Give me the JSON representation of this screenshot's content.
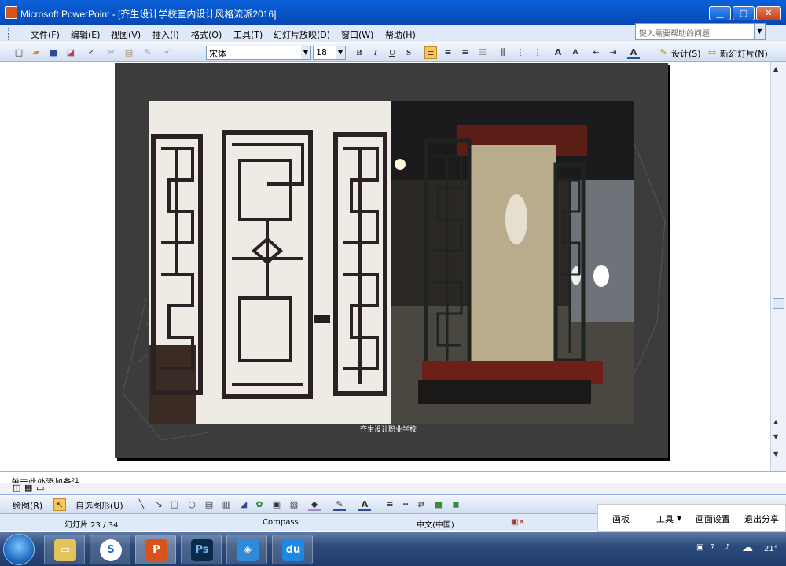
{
  "window": {
    "title": "Microsoft PowerPoint - [齐生设计学校室内设计风格流派2016]"
  },
  "menu": {
    "items": [
      "文件(F)",
      "编辑(E)",
      "视图(V)",
      "插入(I)",
      "格式(O)",
      "工具(T)",
      "幻灯片放映(D)",
      "窗口(W)",
      "帮助(H)"
    ]
  },
  "help_box": {
    "placeholder": "键入需要帮助的问题"
  },
  "toolbar": {
    "font": "宋体",
    "size": "18",
    "bold": "B",
    "italic": "I",
    "underline": "U",
    "shadow": "S",
    "design_label": "设计(S)",
    "new_slide_label": "新幻灯片(N)"
  },
  "slide": {
    "caption": "齐生设计职业学校"
  },
  "notes": {
    "placeholder": "单击此处添加备注"
  },
  "drawbar": {
    "draw_label": "绘图(R)",
    "autoshapes_label": "自选图形(U)"
  },
  "status": {
    "slide": "幻灯片 23 / 34",
    "design": "Compass",
    "language": "中文(中国)"
  },
  "overlay": {
    "items": [
      "画板",
      "工具",
      "画面设置",
      "退出分享"
    ]
  },
  "tray": {
    "temperature": "21°"
  }
}
